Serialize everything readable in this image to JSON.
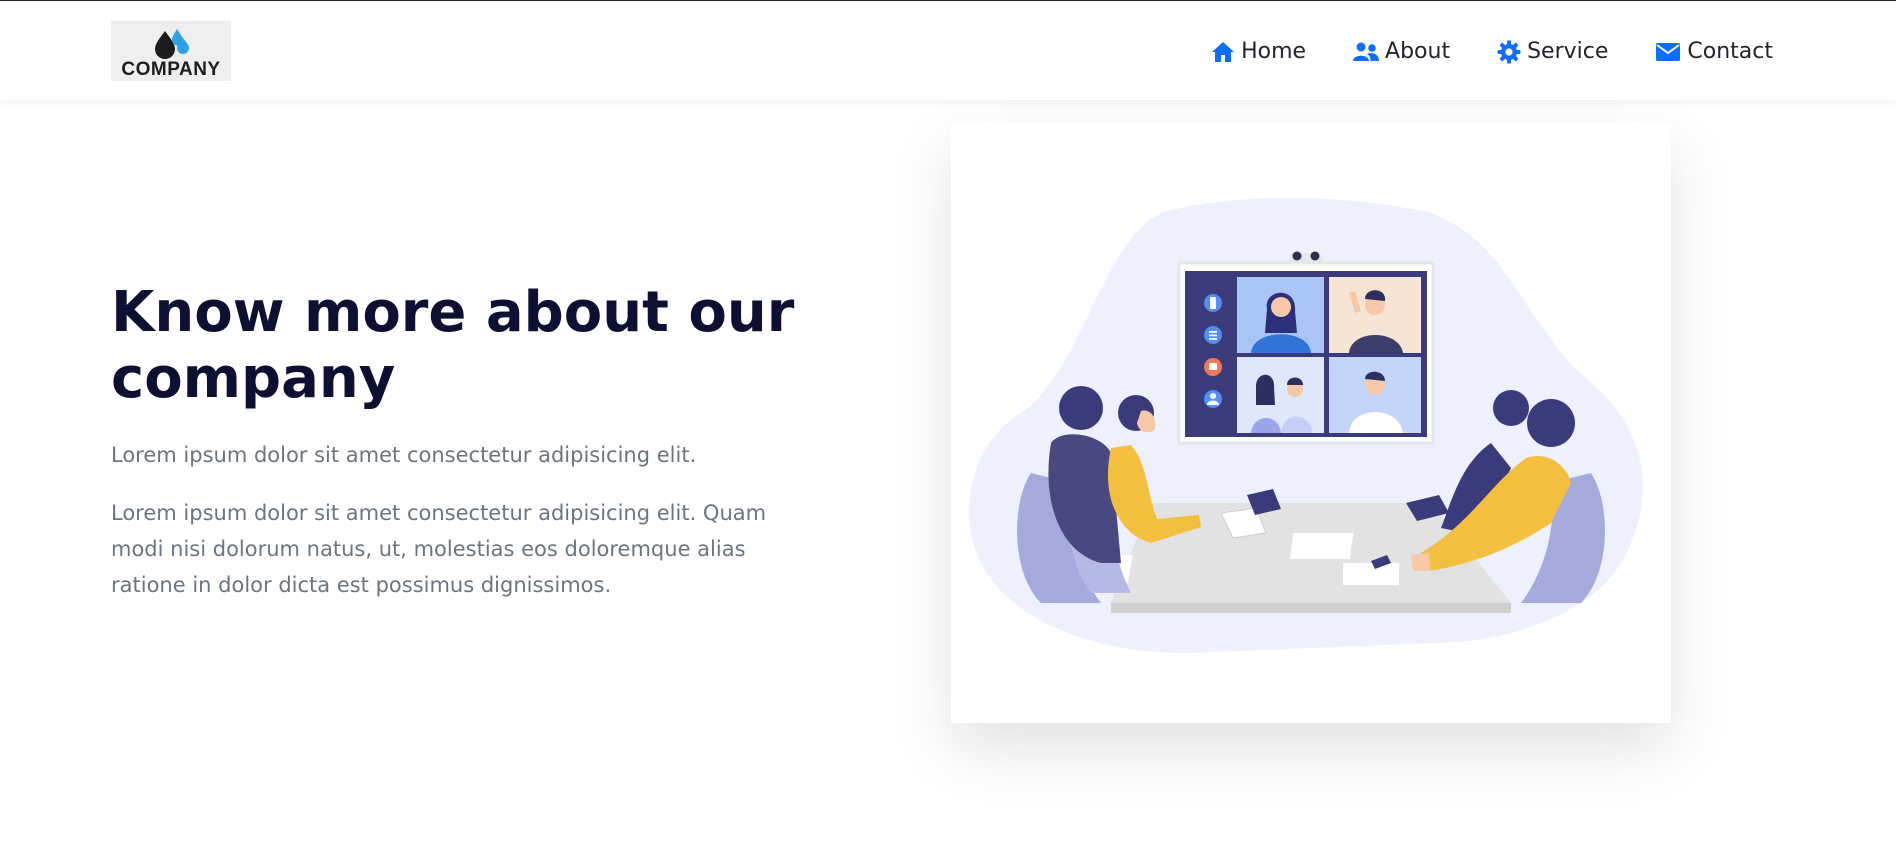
{
  "brand": {
    "logo_text": "COMPANY",
    "logo_icon": "water-drops-icon",
    "colors": {
      "drop_dark": "#1c1c1e",
      "drop_light": "#2ba3e6",
      "logo_bg": "#eeeeef"
    }
  },
  "nav": {
    "items": [
      {
        "label": "Home",
        "icon": "home-icon"
      },
      {
        "label": "About",
        "icon": "users-icon"
      },
      {
        "label": "Service",
        "icon": "gear-icon"
      },
      {
        "label": "Contact",
        "icon": "envelope-icon"
      }
    ],
    "icon_color": "#0d6efd",
    "text_color": "#212529"
  },
  "hero": {
    "title": "Know more about our company",
    "lead": "Lorem ipsum dolor sit amet consectetur adipisicing elit.",
    "body": "Lorem ipsum dolor sit amet consectetur adipisicing elit. Quam modi nisi dolorum natus, ut, molestias eos doloremque alias ratione in dolor dicta est possimus dignissimos.",
    "title_color": "#0d1033",
    "text_color": "#6c757d"
  },
  "illustration": {
    "subject": "video-conference-meeting-illustration",
    "colors": {
      "blob": "#eef0fd",
      "navy": "#3b3a7a",
      "yellow": "#f3bf3f",
      "table": "#e2e2e2",
      "chair": "#a6a9dc"
    }
  }
}
